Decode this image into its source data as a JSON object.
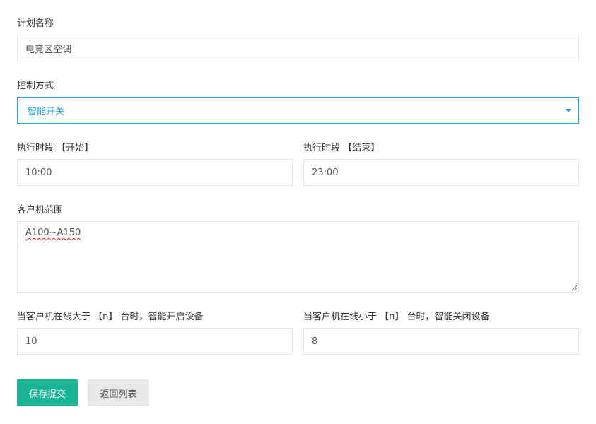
{
  "form": {
    "plan_name": {
      "label": "计划名称",
      "value": "电竞区空调"
    },
    "control_mode": {
      "label": "控制方式",
      "selected": "智能开关"
    },
    "time_start": {
      "label": "执行时段 【开始】",
      "value": "10:00"
    },
    "time_end": {
      "label": "执行时段 【结束】",
      "value": "23:00"
    },
    "client_range": {
      "label": "客户机范围",
      "value": "A100~A150"
    },
    "online_above": {
      "label": "当客户机在线大于 【n】 台时，智能开启设备",
      "value": "10"
    },
    "online_below": {
      "label": "当客户机在线小于 【n】 台时，智能关闭设备",
      "value": "8"
    }
  },
  "actions": {
    "submit_label": "保存提交",
    "back_label": "返回列表"
  },
  "colors": {
    "primary": "#1ab394",
    "select_accent": "#1b9fd6",
    "border": "#e5e6e7",
    "secondary_button": "#e6e8ea"
  }
}
